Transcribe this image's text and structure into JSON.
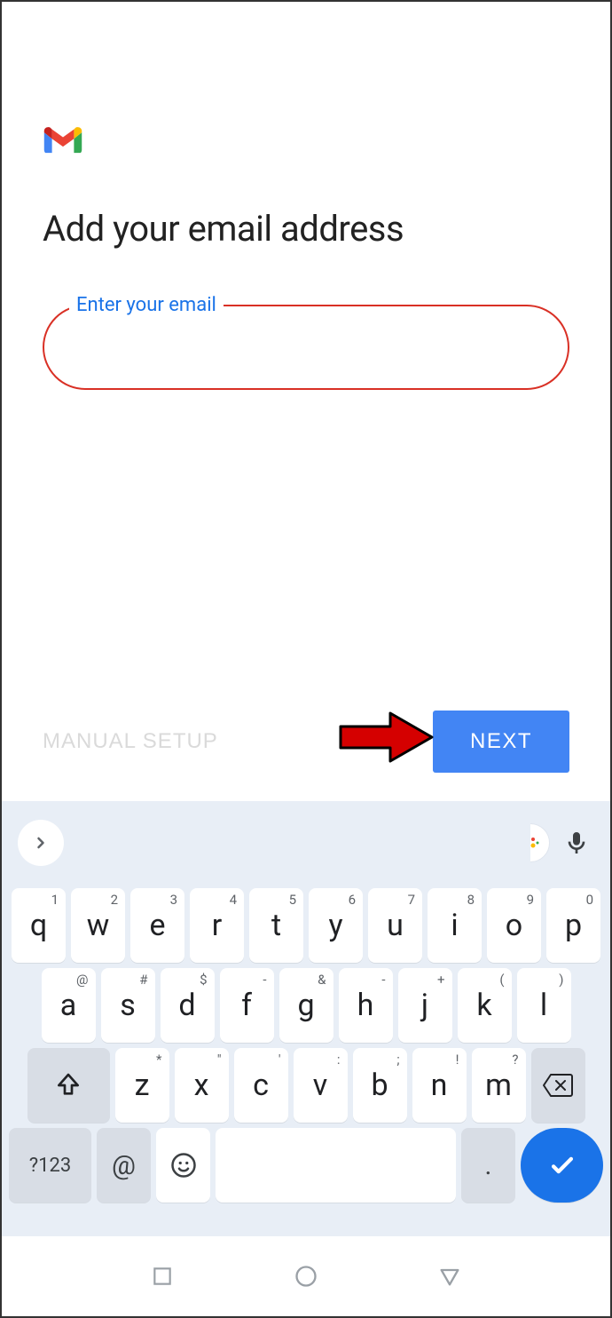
{
  "page": {
    "title": "Add your email address",
    "email_label": "Enter your email",
    "email_value": "",
    "manual_setup_label": "MANUAL SETUP",
    "next_label": "NEXT"
  },
  "keyboard": {
    "row1": [
      {
        "main": "q",
        "sup": "1"
      },
      {
        "main": "w",
        "sup": "2"
      },
      {
        "main": "e",
        "sup": "3"
      },
      {
        "main": "r",
        "sup": "4"
      },
      {
        "main": "t",
        "sup": "5"
      },
      {
        "main": "y",
        "sup": "6"
      },
      {
        "main": "u",
        "sup": "7"
      },
      {
        "main": "i",
        "sup": "8"
      },
      {
        "main": "o",
        "sup": "9"
      },
      {
        "main": "p",
        "sup": "0"
      }
    ],
    "row2": [
      {
        "main": "a",
        "sup": "@"
      },
      {
        "main": "s",
        "sup": "#"
      },
      {
        "main": "d",
        "sup": "$"
      },
      {
        "main": "f",
        "sup": "-"
      },
      {
        "main": "g",
        "sup": "&"
      },
      {
        "main": "h",
        "sup": "-"
      },
      {
        "main": "j",
        "sup": "+"
      },
      {
        "main": "k",
        "sup": "("
      },
      {
        "main": "l",
        "sup": ")"
      }
    ],
    "row3": [
      {
        "main": "z",
        "sup": "*"
      },
      {
        "main": "x",
        "sup": "\""
      },
      {
        "main": "c",
        "sup": "'"
      },
      {
        "main": "v",
        "sup": ":"
      },
      {
        "main": "b",
        "sup": ";"
      },
      {
        "main": "n",
        "sup": "!"
      },
      {
        "main": "m",
        "sup": "?"
      }
    ],
    "symbols_key": "?123",
    "at_key": "@",
    "period_key": "."
  }
}
